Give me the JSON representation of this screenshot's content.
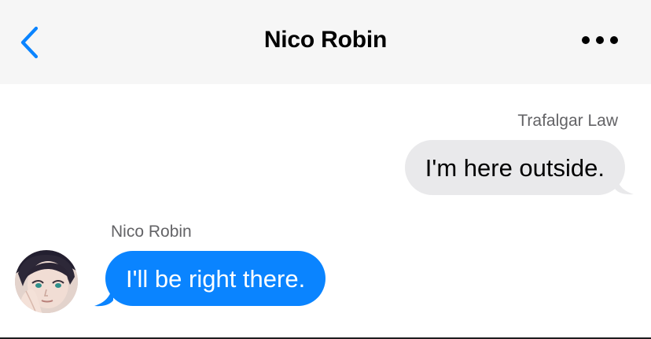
{
  "nav": {
    "title": "Nico Robin",
    "back_icon": "chevron-left-icon",
    "more_icon": "ellipsis-icon"
  },
  "messages": [
    {
      "direction": "outgoing",
      "sender": "Trafalgar Law",
      "text": "I'm here outside."
    },
    {
      "direction": "incoming",
      "sender": "Nico Robin",
      "text": "I'll be right there.",
      "avatar": "contact-avatar"
    }
  ],
  "colors": {
    "accent": "#0a84ff",
    "nav_background": "#f6f6f6",
    "outgoing_bubble": "#e9e9eb",
    "incoming_bubble": "#0a84ff",
    "sender_label": "#636366"
  }
}
